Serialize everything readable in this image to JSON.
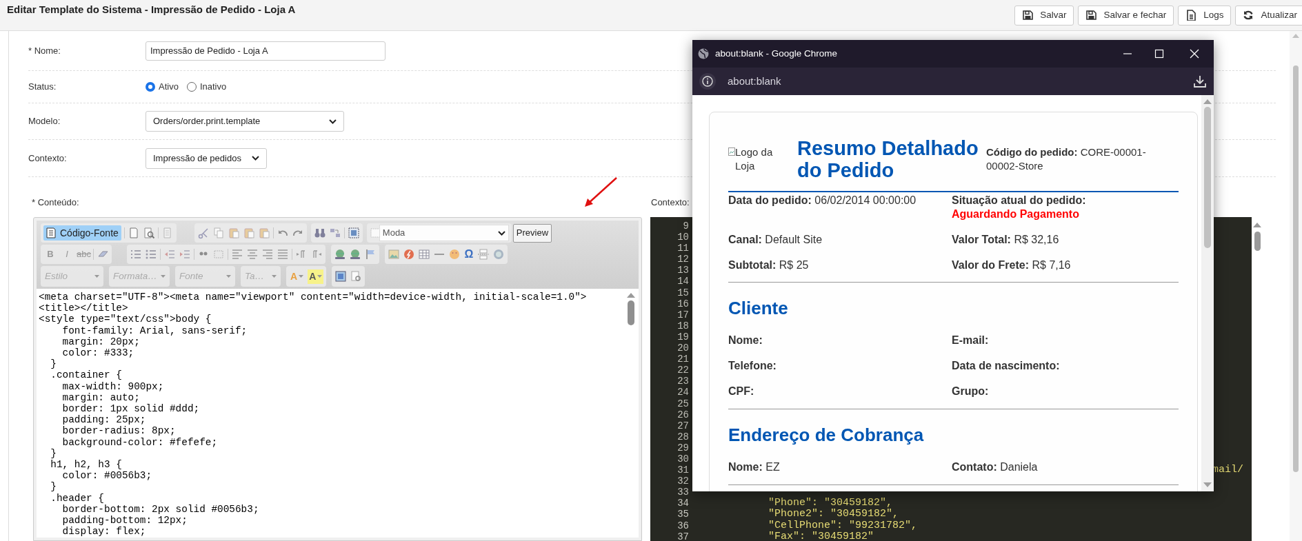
{
  "page_title": "Editar Template do Sistema - Impressão de Pedido - Loja A",
  "actions": [
    {
      "label": "Salvar",
      "kind": "save"
    },
    {
      "label": "Salvar e fechar",
      "kind": "save"
    },
    {
      "label": "Logs",
      "kind": "document"
    },
    {
      "label": "Atualizar",
      "kind": "refresh"
    }
  ],
  "form": {
    "name": {
      "label": "* Nome:",
      "value": "Impressão de Pedido - Loja A"
    },
    "status": {
      "label": "Status:",
      "options": [
        {
          "label": "Ativo",
          "selected": true
        },
        {
          "label": "Inativo",
          "selected": false
        }
      ]
    },
    "model": {
      "label": "Modelo:",
      "value": "Orders/order.print.template"
    },
    "context": {
      "label": "Contexto:",
      "value": "Impressão de pedidos"
    }
  },
  "content_label": "* Conteúdo:",
  "context_label": "Contexto:",
  "editor": {
    "source_button": {
      "label": "Código-Fonte",
      "selected": true
    },
    "mode_combo": "Moda",
    "tooltip": "Preview",
    "format_buttons": [
      "B",
      "I",
      "abc"
    ],
    "combos": [
      "Estilo",
      "Formata…",
      "Fonte",
      "Ta…"
    ],
    "color_buttons": [
      "A",
      "A"
    ],
    "special_char": "Ω",
    "code_lines": [
      "<meta charset=\"UTF-8\"><meta name=\"viewport\" content=\"width=device-width, initial-scale=1.0\">",
      "<title></title>",
      "<style type=\"text/css\">body {",
      "    font-family: Arial, sans-serif;",
      "    margin: 20px;",
      "    color: #333;",
      "  }",
      "  .container {",
      "    max-width: 900px;",
      "    margin: auto;",
      "    border: 1px solid #ddd;",
      "    padding: 25px;",
      "    border-radius: 8px;",
      "    background-color: #fefefe;",
      "  }",
      "  h1, h2, h3 {",
      "    color: #0056b3;",
      "  }",
      "  .header {",
      "    border-bottom: 2px solid #0056b3;",
      "    padding-bottom: 12px;",
      "    display: flex;"
    ]
  },
  "context_code": [
    {
      "number": "9"
    },
    {
      "number": "10"
    },
    {
      "number": "11"
    },
    {
      "number": "12"
    },
    {
      "number": "13"
    },
    {
      "number": "14"
    },
    {
      "number": "15"
    },
    {
      "number": "16"
    },
    {
      "number": "17"
    },
    {
      "number": "18"
    },
    {
      "number": "19"
    },
    {
      "number": "20"
    },
    {
      "number": "21"
    },
    {
      "number": "22"
    },
    {
      "number": "23"
    },
    {
      "number": "24"
    },
    {
      "number": "25"
    },
    {
      "number": "26"
    },
    {
      "number": "27"
    },
    {
      "number": "28"
    },
    {
      "number": "29"
    },
    {
      "number": "30"
    },
    {
      "number": "31",
      "code": "mail/",
      "kind": "tail"
    },
    {
      "number": "32"
    },
    {
      "number": "33"
    },
    {
      "number": "34",
      "code": "        \"Phone\": \"30459182\",",
      "kind": "line"
    },
    {
      "number": "35",
      "code": "        \"Phone2\": \"30459182\",",
      "kind": "line"
    },
    {
      "number": "36",
      "code": "        \"CellPhone\": \"99231782\",",
      "kind": "line"
    },
    {
      "number": "37",
      "code": "        \"Fax\": \"30459182\"",
      "kind": "line"
    }
  ],
  "popup": {
    "title": "about:blank - Google Chrome",
    "address": "about:blank",
    "document": {
      "logo_alt": "Logo da Loja",
      "heading": "Resumo Detalhado do Pedido",
      "order_code": {
        "label": "Código do pedido:",
        "value": "CORE-00001-00002-Store"
      },
      "summary": [
        {
          "label": "Data do pedido:",
          "value": "06/02/2014 00:00:00"
        },
        {
          "label": "Situação atual do pedido:",
          "value": "Aguardando Pagamento",
          "kind": "status"
        },
        {
          "label": "Canal:",
          "value": "Default Site"
        },
        {
          "label": "Valor Total:",
          "value": "R$ 32,16"
        },
        {
          "label": "Subtotal:",
          "value": "R$ 25"
        },
        {
          "label": "Valor do Frete:",
          "value": "R$ 7,16"
        }
      ],
      "sections": [
        {
          "title": "Cliente",
          "fields": [
            {
              "label": "Nome:"
            },
            {
              "label": "E-mail:"
            },
            {
              "label": "Telefone:"
            },
            {
              "label": "Data de nascimento:"
            },
            {
              "label": "CPF:"
            },
            {
              "label": "Grupo:"
            }
          ]
        },
        {
          "title": "Endereço de Cobrança",
          "fields": [
            {
              "label": "Nome:",
              "value": "EZ"
            },
            {
              "label": "Contato:",
              "value": "Daniela"
            }
          ]
        }
      ]
    }
  }
}
